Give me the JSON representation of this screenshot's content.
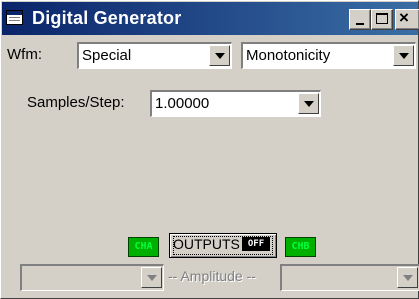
{
  "window": {
    "title": "Digital Generator"
  },
  "titlebar_buttons": {
    "minimize": "_",
    "maximize": "□",
    "close": "×"
  },
  "waveform": {
    "label": "Wfm:",
    "type_value": "Special",
    "subtype_value": "Monotonicity"
  },
  "samples": {
    "label": "Samples/Step:",
    "value": "1.00000"
  },
  "outputs": {
    "cha_label": "CHA",
    "button_label": "OUTPUTS",
    "state_label": "OFF",
    "chb_label": "CHB"
  },
  "amplitude": {
    "label": "-- Amplitude --",
    "left_value": "",
    "right_value": ""
  },
  "colors": {
    "titlebar": "#0a246a",
    "face": "#d4d0c8",
    "channel_on": "#00b000",
    "channel_text": "#00ff40"
  }
}
